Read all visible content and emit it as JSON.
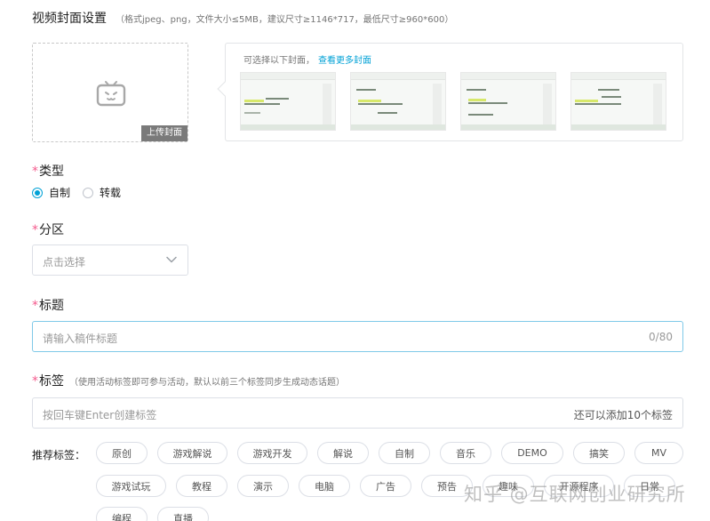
{
  "cover": {
    "title": "视频封面设置",
    "hint": "（格式jpeg、png，文件大小≤5MB，建议尺寸≥1146*717，最低尺寸≥960*600）",
    "upload_label": "上传封面",
    "upload_icon": "tv-icon",
    "suggest_text": "可选择以下封面，",
    "suggest_more": "查看更多封面",
    "thumbnail_count": 4
  },
  "type_field": {
    "required_mark": "*",
    "label": "类型",
    "options": [
      {
        "label": "自制",
        "selected": true
      },
      {
        "label": "转载",
        "selected": false
      }
    ]
  },
  "category_field": {
    "required_mark": "*",
    "label": "分区",
    "placeholder": "点击选择"
  },
  "title_field": {
    "required_mark": "*",
    "label": "标题",
    "placeholder": "请输入稿件标题",
    "counter": "0/80"
  },
  "tags_field": {
    "required_mark": "*",
    "label": "标签",
    "hint": "（使用活动标签即可参与活动，默认以前三个标签同步生成动态话题）",
    "placeholder": "按回车键Enter创建标签",
    "remaining": "还可以添加10个标签"
  },
  "recommended": {
    "label": "推荐标签：",
    "row1": [
      "原创",
      "游戏解说",
      "游戏开发",
      "解说",
      "自制",
      "音乐",
      "DEMO",
      "搞笑",
      "MV"
    ],
    "row2": [
      "游戏试玩",
      "教程",
      "演示",
      "电脑",
      "广告",
      "预告",
      "趣味",
      "开源程序",
      "日常"
    ],
    "row3": [
      "编程",
      "直播"
    ]
  },
  "watermark": "知乎 @互联网创业研究所",
  "colors": {
    "accent": "#00a1d6",
    "required": "#f45a8d",
    "focus_border": "#7fc9e8"
  }
}
